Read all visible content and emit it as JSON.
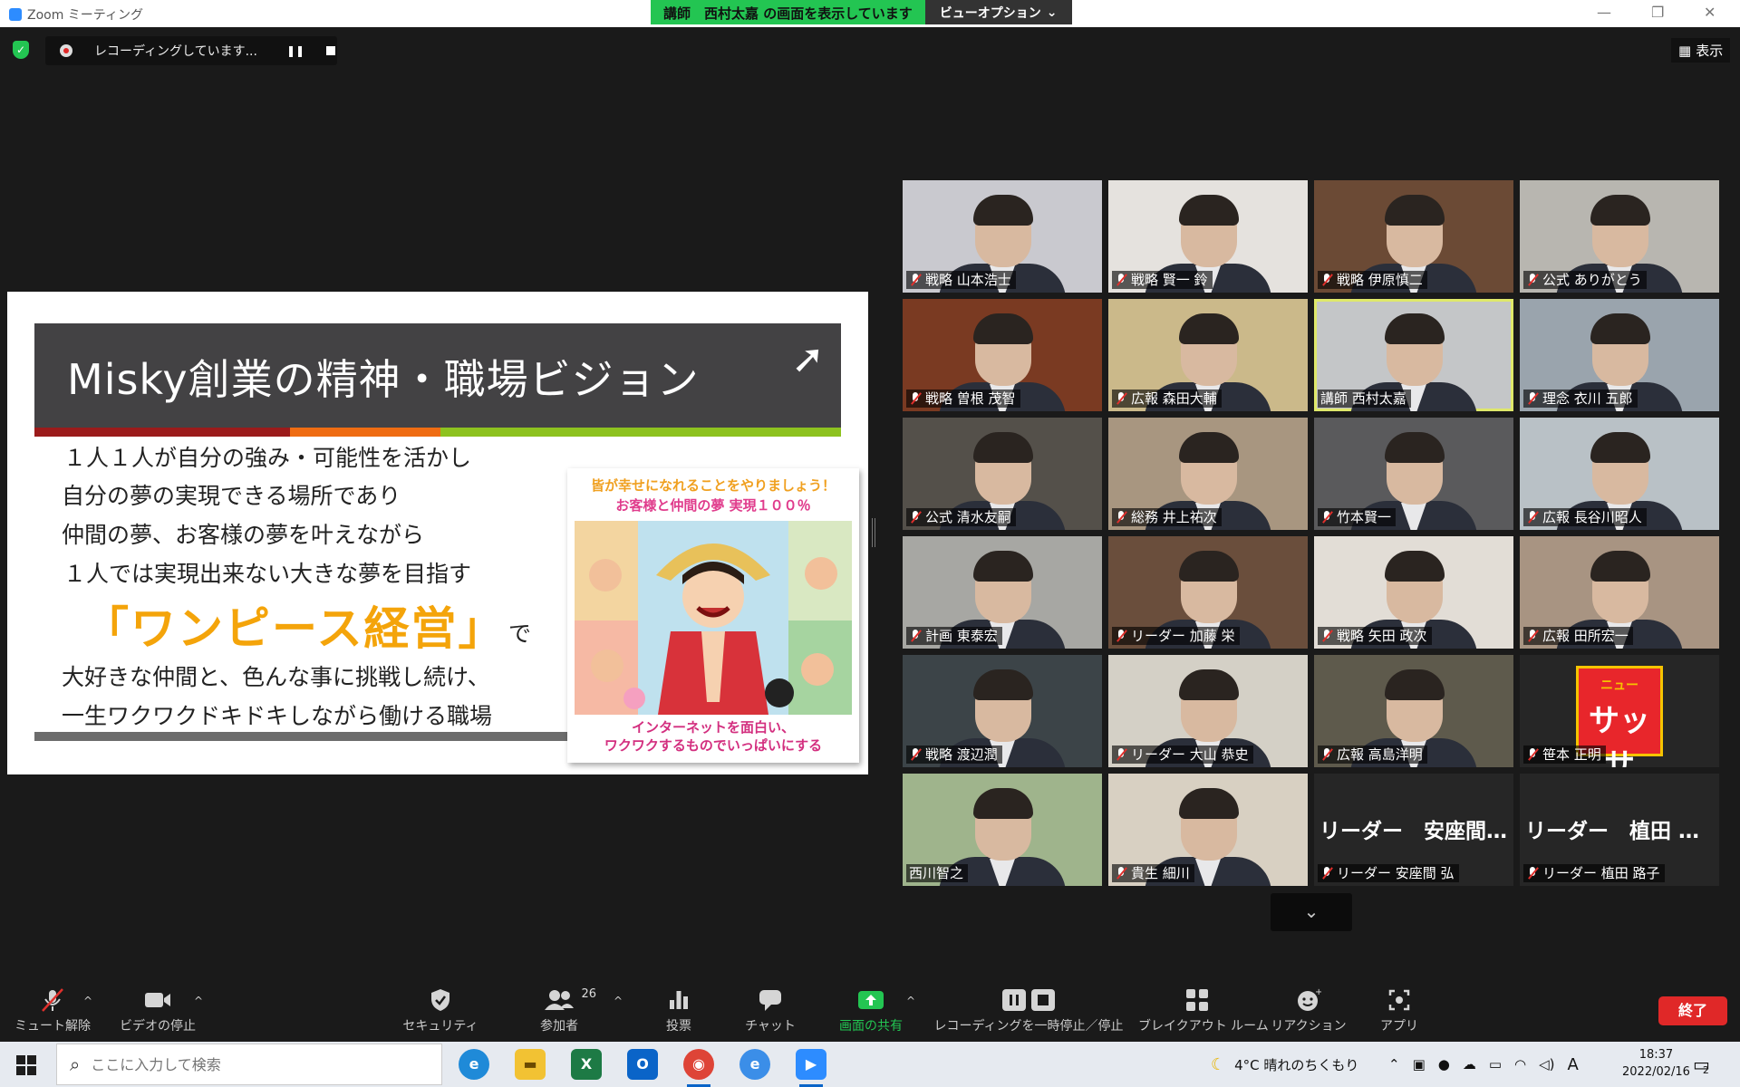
{
  "window": {
    "title": "Zoom ミーティング",
    "share_banner": "講師　西村太嘉 の画面を表示しています",
    "view_options": "ビューオプション",
    "minimize": "—",
    "restore": "❐",
    "close": "✕"
  },
  "recording": {
    "text": "レコーディングしています...",
    "pause": "❚❚"
  },
  "view_button": "表示",
  "slide": {
    "title": "Misky創業の精神・職場ビジョン",
    "lines": [
      "１人１人が自分の強み・可能性を活かし",
      "自分の夢の実現できる場所であり",
      "仲間の夢、お客様の夢を叶えながら",
      "１人では実現出来ない大きな夢を目指す",
      "大好きな仲間と、色んな事に挑戦し続け、",
      "一生ワクワクドキドキしながら働ける職場"
    ],
    "highlight": "「ワンピース経営」",
    "particle": "で",
    "image_caption_top1": "皆が幸せになれることをやりましょう！",
    "image_caption_top2": "お客様と仲間の夢 実現１００％",
    "image_caption_bottom1": "インターネットを面白い、",
    "image_caption_bottom2": "ワクワクするものでいっぱいにする",
    "colors": {
      "header": "#434244",
      "stripe_red": "#9b1b1b",
      "stripe_orange": "#ef6c12",
      "stripe_green": "#8dc21f",
      "highlight": "#f4a40a"
    }
  },
  "participants": [
    {
      "name": "戦略  山本浩士",
      "muted": true,
      "bg": "#c9c9cf"
    },
    {
      "name": "戦略  賢一 鈴",
      "muted": true,
      "bg": "#e5e2de"
    },
    {
      "name": "戦略  伊原慎二",
      "muted": true,
      "bg": "#6b4a35"
    },
    {
      "name": "公式  ありがとう",
      "muted": true,
      "bg": "#b8b6b0"
    },
    {
      "name": "戦略  曽根  茂智",
      "muted": true,
      "bg": "#7a3a22"
    },
    {
      "name": "広報  森田大輔",
      "muted": true,
      "bg": "#cbb98a"
    },
    {
      "name": "講師  西村太嘉",
      "muted": false,
      "bg": "#c4c6c8",
      "active": true
    },
    {
      "name": "理念 衣川 五郎",
      "muted": true,
      "bg": "#9aa4ad"
    },
    {
      "name": "公式  清水友嗣",
      "muted": true,
      "bg": "#54504a"
    },
    {
      "name": "総務  井上祐次",
      "muted": true,
      "bg": "#a89680"
    },
    {
      "name": "竹本賢一",
      "muted": true,
      "bg": "#5a5a5c"
    },
    {
      "name": "広報  長谷川昭人",
      "muted": true,
      "bg": "#b9c1c6"
    },
    {
      "name": "計画  東泰宏",
      "muted": true,
      "bg": "#a7a7a3"
    },
    {
      "name": "リーダー  加藤 栄",
      "muted": true,
      "bg": "#6a4e3c"
    },
    {
      "name": "戦略  矢田 政次",
      "muted": true,
      "bg": "#e2ddd6"
    },
    {
      "name": "広報  田所宏一",
      "muted": true,
      "bg": "#a89482"
    },
    {
      "name": "戦略 渡辺潤",
      "muted": true,
      "bg": "#3c4448"
    },
    {
      "name": "リーダー 大山 恭史",
      "muted": true,
      "bg": "#d4d0c6"
    },
    {
      "name": "広報 高島洋明",
      "muted": true,
      "bg": "#5e5a4c"
    },
    {
      "name": "笹本 正明",
      "muted": true,
      "bg": "#262626",
      "snack": true
    },
    {
      "name": "西川智之",
      "muted": false,
      "bg": "#9fb48c"
    },
    {
      "name": "貴生 細川",
      "muted": true,
      "bg": "#d8d0c2"
    },
    {
      "name": "リーダー  安座間  弘",
      "muted": true,
      "bg": "#262626",
      "no_video": true,
      "big": "リーダー　安座間  弘"
    },
    {
      "name": "リーダー  植田 路子",
      "muted": true,
      "bg": "#262626",
      "no_video": true,
      "big": "リーダー　植田 路子"
    }
  ],
  "snack_text": {
    "top": "ニュー",
    "main": "サッサ"
  },
  "toolbar": {
    "unmute": "ミュート解除",
    "stop_video": "ビデオの停止",
    "security": "セキュリティ",
    "participants": "参加者",
    "participants_count": "26",
    "polls": "投票",
    "chat": "チャット",
    "share": "画面の共有",
    "recording_control": "レコーディングを一時停止／停止",
    "breakout": "ブレイクアウト ルーム",
    "reactions": "リアクション",
    "apps": "アプリ",
    "end": "終了"
  },
  "taskbar": {
    "search_placeholder": "ここに入力して検索",
    "weather": "4°C  晴れのちくもり",
    "ime": "A",
    "time": "18:37",
    "date": "2022/02/16",
    "notifications": "2"
  }
}
